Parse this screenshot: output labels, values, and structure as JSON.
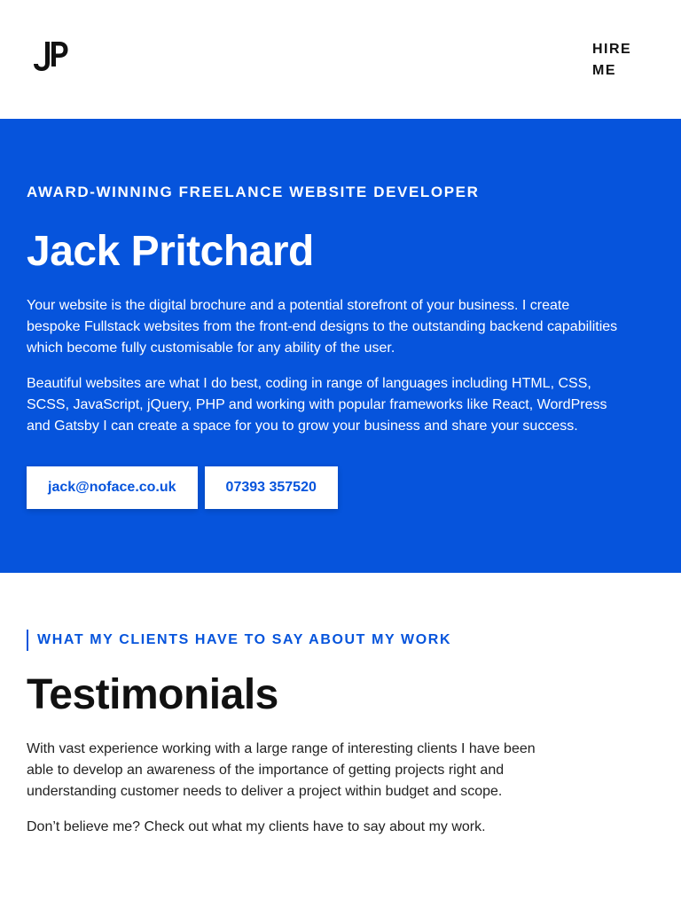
{
  "header": {
    "logo_icon": "jp-monogram-logo",
    "hire_label": "HIRE ME"
  },
  "hero": {
    "background": "#0654dc",
    "eyebrow": "AWARD-WINNING FREELANCE WEBSITE DEVELOPER",
    "title": "Jack Pritchard",
    "paragraphs": [
      "Your website is the digital brochure and a potential storefront of your business. I create bespoke Fullstack websites from the front-end designs to the outstanding backend capabilities which become fully customisable for any ability of the user.",
      "Beautiful websites are what I do best, coding in range of languages including HTML, CSS, SCSS, JavaScript, jQuery, PHP and working with popular frameworks like React, WordPress and Gatsby I can create a space for you to grow your business and share your success."
    ],
    "buttons": {
      "email": "jack@noface.co.uk",
      "phone": "07393 357520"
    }
  },
  "testimonials": {
    "eyebrow": "WHAT MY CLIENTS HAVE TO SAY ABOUT MY WORK",
    "title": "Testimonials",
    "paragraphs": [
      "With vast experience working with a large range of interesting clients I have been able to develop an awareness of the importance of getting projects right and understanding customer needs to deliver a project within budget and scope.",
      "Don’t believe me? Check out what my clients have to say about my work."
    ]
  }
}
